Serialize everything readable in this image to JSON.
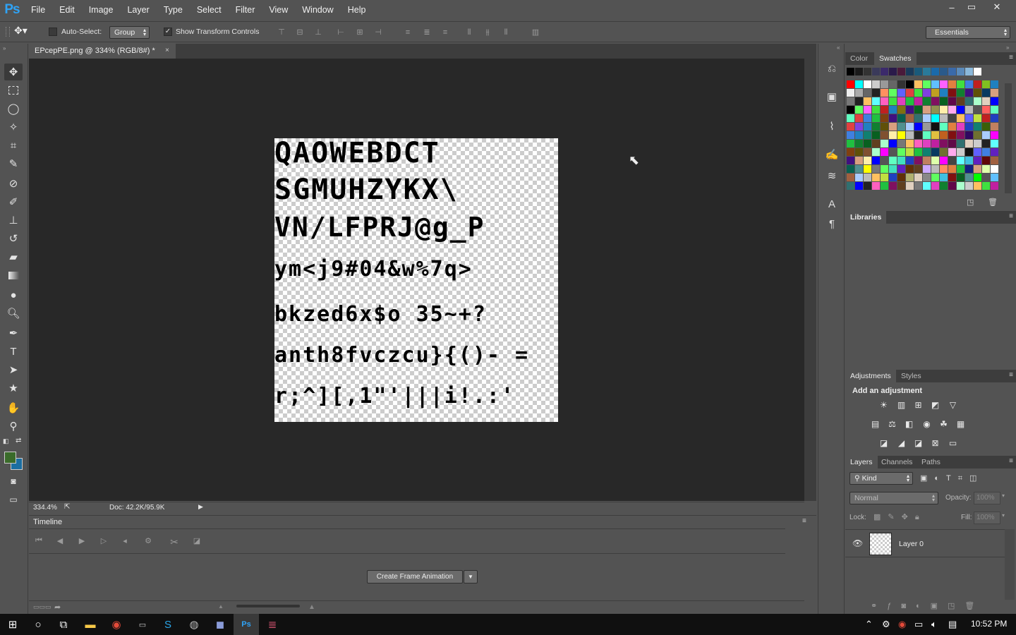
{
  "app": {
    "logo": "Ps"
  },
  "menu": [
    "File",
    "Edit",
    "Image",
    "Layer",
    "Type",
    "Select",
    "Filter",
    "View",
    "Window",
    "Help"
  ],
  "window_controls": {
    "minimize": "–",
    "restore": "▭",
    "close": "✕"
  },
  "options": {
    "auto_select_label": "Auto-Select:",
    "auto_select_checked": false,
    "auto_select_mode": "Group",
    "show_transform_label": "Show Transform Controls",
    "show_transform_checked": true,
    "workspace": "Essentials"
  },
  "document": {
    "tab_title": "EPcepPE.png @ 334% (RGB/8#) *",
    "close_glyph": "×",
    "glyph_lines": [
      "QAOWEBDCT",
      "SGMUHZYKX\\",
      "VN/LFPRJ@g_P",
      "ym<j9#04&w%7q>",
      "bkzed6x$o  35~+?",
      "anth8fvczcu}{()- =",
      "r;^][,1\"'|||i!.:'"
    ]
  },
  "status": {
    "zoom": "334.4%",
    "doc": "Doc: 42.2K/95.9K"
  },
  "timeline": {
    "tab": "Timeline",
    "create_button": "Create Frame Animation"
  },
  "panels": {
    "color_tab": "Color",
    "swatches_tab": "Swatches",
    "libraries_tab": "Libraries",
    "adjustments_tab": "Adjustments",
    "styles_tab": "Styles",
    "add_adjustment": "Add an adjustment",
    "layers_tab": "Layers",
    "channels_tab": "Channels",
    "paths_tab": "Paths",
    "kind_filter": "Kind",
    "blend_mode": "Normal",
    "opacity_label": "Opacity:",
    "opacity_value": "100%",
    "lock_label": "Lock:",
    "fill_label": "Fill:",
    "fill_value": "100%",
    "layer_name": "Layer 0"
  },
  "colors": {
    "foreground": "#3a6b2a",
    "background": "#1b6ea1",
    "swatch_row1": [
      "#000000",
      "#1a1a1a",
      "#333333",
      "#3a3a5a",
      "#3b2a6b",
      "#2a1a4a",
      "#4a1a3a",
      "#1a3a5a",
      "#1a5a7a",
      "#2a7a9a",
      "#1a6aaa",
      "#2a5a8a",
      "#3a6aaa",
      "#5a8aba",
      "#8ab8da",
      "#ffffff"
    ],
    "swatch_palette": [
      "#ff0000",
      "#ffff00",
      "#00ff00",
      "#00ffff",
      "#0000ff",
      "#ff00ff",
      "#ffffff",
      "#eeeeee",
      "#dddddd",
      "#cccccc",
      "#bbbbbb",
      "#aaaaaa",
      "#999999",
      "#888888",
      "#777777",
      "#666666",
      "#555555",
      "#444444",
      "#333333",
      "#222222",
      "#111111",
      "#000000",
      "#ff6060",
      "#ff9060",
      "#ffc060",
      "#ffff60",
      "#c0ff60",
      "#60ff60",
      "#60ffc0",
      "#60ffff",
      "#60c0ff",
      "#6060ff",
      "#c060ff",
      "#ff60ff",
      "#ff60c0",
      "#e04040",
      "#e08040",
      "#e0c040",
      "#c0e040",
      "#40e040",
      "#40e0c0",
      "#40c0e0",
      "#4080e0",
      "#8040e0",
      "#e040c0",
      "#c02020",
      "#c06020",
      "#c0a020",
      "#80c020",
      "#20c040",
      "#20c0a0",
      "#2080c0",
      "#2040c0",
      "#6020c0",
      "#c020a0",
      "#801010",
      "#804010",
      "#807010",
      "#508010",
      "#108030",
      "#108070",
      "#105080",
      "#102080",
      "#401080",
      "#801060",
      "#600808",
      "#603008",
      "#605008",
      "#3a6008",
      "#086020",
      "#086050",
      "#083a60",
      "#081860",
      "#300860",
      "#600848",
      "#d8a080",
      "#c08060",
      "#a06040",
      "#805030",
      "#604020",
      "#b0b070",
      "#909050",
      "#707030",
      "#509090",
      "#307070",
      "#ffaaaa",
      "#ffccaa",
      "#ffeeaa",
      "#ddffaa",
      "#aaffcc",
      "#aaeeff",
      "#aaccff",
      "#ccaaff",
      "#ffaaee",
      "#e0d0c0"
    ]
  }
}
